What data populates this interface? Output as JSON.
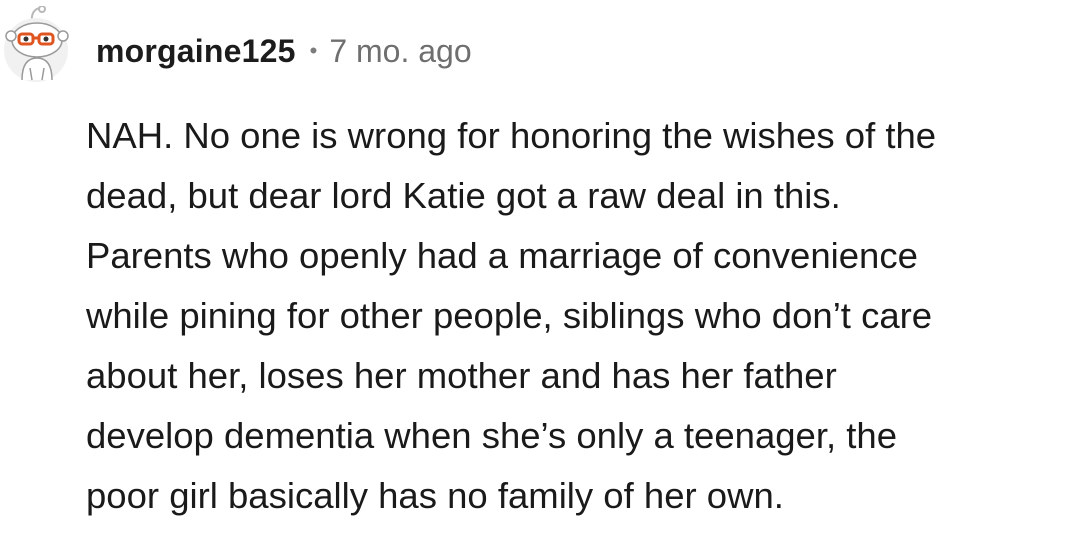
{
  "comment": {
    "avatar_icon": "snoo-avatar-with-glasses-icon",
    "username": "morgaine125",
    "separator": "•",
    "timestamp": "7 mo. ago",
    "body_lines": [
      "NAH. No one is wrong for honoring the wishes of the",
      "dead, but dear lord Katie got a raw deal in this.",
      "Parents who openly had a marriage of convenience",
      "while pining for other people, siblings who don’t care",
      "about her, loses her mother and has her father",
      "develop dementia when she’s only a teenager, the",
      "poor girl basically has no family of her own."
    ]
  },
  "colors": {
    "username": "#1c1c1c",
    "timestamp": "#6f6f6f",
    "body_text": "#1a1a1b",
    "glasses": "#e0541f"
  }
}
